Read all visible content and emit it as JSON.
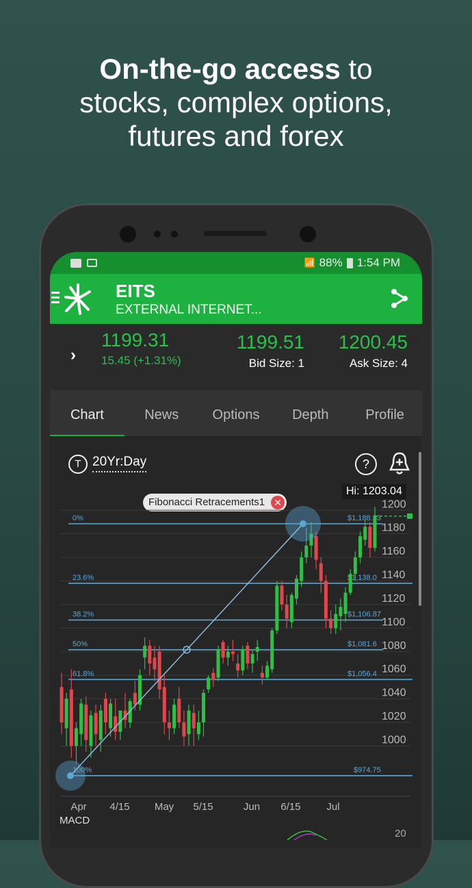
{
  "headline": {
    "bold": "On-the-go access",
    "rest_line1": " to",
    "line2": "stocks, complex options,",
    "line3": "futures and forex"
  },
  "status_bar": {
    "battery": "88%",
    "time": "1:54 PM",
    "icons": [
      "message-icon",
      "gmail-icon",
      "wifi-icon",
      "signal-icon",
      "battery-icon"
    ]
  },
  "header": {
    "symbol": "EITS",
    "name": "EXTERNAL INTERNET...",
    "icons": [
      "menu-icon",
      "logo-icon",
      "share-icon"
    ]
  },
  "quote": {
    "last": "1199.31",
    "change": "15.45 (+1.31%)",
    "bid": "1199.51",
    "bid_size": "Bid Size: 1",
    "ask": "1200.45",
    "ask_size": "Ask Size: 4"
  },
  "tabs": [
    {
      "label": "Chart",
      "active": true
    },
    {
      "label": "News"
    },
    {
      "label": "Options"
    },
    {
      "label": "Depth"
    },
    {
      "label": "Profile"
    }
  ],
  "chart_toolbar": {
    "period": "20Yr:Day",
    "hi": "Hi: 1203.04",
    "drawing_label": "Fibonacci Retracements1"
  },
  "colors": {
    "up": "#2fbf45",
    "down": "#e0474c",
    "fib": "#5aa7d6",
    "accent": "#1db23f"
  },
  "chart_data": {
    "type": "candlestick",
    "y_ticks": [
      1200,
      1180,
      1160,
      1140,
      1120,
      1100,
      1080,
      1060,
      1040,
      1020,
      1000
    ],
    "x_ticks": [
      "Apr",
      "4/15",
      "May",
      "5/15",
      "Jun",
      "6/15",
      "Jul"
    ],
    "fib_levels": [
      {
        "pct": "0%",
        "price": "$1,188.53",
        "value": 1188.53
      },
      {
        "pct": "23.6%",
        "price": "$1,138.0",
        "value": 1138.0
      },
      {
        "pct": "38.2%",
        "price": "$1,106.87",
        "value": 1106.87
      },
      {
        "pct": "50%",
        "price": "$1,081.6",
        "value": 1081.6
      },
      {
        "pct": "61.8%",
        "price": "$1,056.4",
        "value": 1056.4
      },
      {
        "pct": "100%",
        "price": "$974.75",
        "value": 974.75
      }
    ],
    "candles": [
      [
        1050,
        1062,
        1010,
        1020
      ],
      [
        1015,
        1045,
        1000,
        1040
      ],
      [
        1048,
        1065,
        990,
        1000
      ],
      [
        1000,
        1020,
        985,
        1015
      ],
      [
        1010,
        1040,
        1000,
        1036
      ],
      [
        1035,
        1042,
        995,
        1005
      ],
      [
        1000,
        1030,
        990,
        1026
      ],
      [
        1028,
        1035,
        1000,
        1010
      ],
      [
        1005,
        1035,
        995,
        1030
      ],
      [
        1040,
        1045,
        1010,
        1020
      ],
      [
        1015,
        1040,
        1008,
        1036
      ],
      [
        1025,
        1040,
        1005,
        1012
      ],
      [
        1012,
        1030,
        1005,
        1030
      ],
      [
        1030,
        1045,
        1015,
        1022
      ],
      [
        1020,
        1040,
        1015,
        1038
      ],
      [
        1045,
        1055,
        1030,
        1035
      ],
      [
        1035,
        1065,
        1030,
        1060
      ],
      [
        1075,
        1092,
        1065,
        1085
      ],
      [
        1085,
        1090,
        1060,
        1070
      ],
      [
        1075,
        1085,
        1055,
        1065
      ],
      [
        1080,
        1085,
        1040,
        1048
      ],
      [
        1050,
        1060,
        1010,
        1020
      ],
      [
        1020,
        1030,
        1005,
        1015
      ],
      [
        1015,
        1040,
        1010,
        1035
      ],
      [
        1040,
        1050,
        1015,
        1020
      ],
      [
        1020,
        1030,
        1000,
        1008
      ],
      [
        1010,
        1035,
        1000,
        1030
      ],
      [
        1028,
        1035,
        1000,
        1015
      ],
      [
        1010,
        1030,
        1005,
        1020
      ],
      [
        1020,
        1048,
        1008,
        1045
      ],
      [
        1048,
        1060,
        1045,
        1058
      ],
      [
        1062,
        1066,
        1050,
        1056
      ],
      [
        1058,
        1085,
        1055,
        1082
      ],
      [
        1088,
        1090,
        1070,
        1075
      ],
      [
        1075,
        1085,
        1068,
        1080
      ],
      [
        1080,
        1090,
        1072,
        1078
      ],
      [
        1070,
        1078,
        1058,
        1064
      ],
      [
        1064,
        1085,
        1060,
        1082
      ],
      [
        1085,
        1088,
        1065,
        1070
      ],
      [
        1070,
        1082,
        1062,
        1078
      ],
      [
        1080,
        1090,
        1072,
        1084
      ],
      [
        1062,
        1068,
        1052,
        1058
      ],
      [
        1058,
        1072,
        1056,
        1068
      ],
      [
        1065,
        1100,
        1062,
        1098
      ],
      [
        1098,
        1140,
        1095,
        1136
      ],
      [
        1136,
        1140,
        1115,
        1120
      ],
      [
        1120,
        1128,
        1100,
        1108
      ],
      [
        1105,
        1130,
        1100,
        1128
      ],
      [
        1125,
        1145,
        1120,
        1142
      ],
      [
        1140,
        1165,
        1135,
        1160
      ],
      [
        1160,
        1185,
        1155,
        1170
      ],
      [
        1170,
        1190,
        1160,
        1180
      ],
      [
        1178,
        1182,
        1150,
        1158
      ],
      [
        1155,
        1160,
        1130,
        1140
      ],
      [
        1140,
        1145,
        1100,
        1108
      ],
      [
        1108,
        1115,
        1095,
        1100
      ],
      [
        1100,
        1120,
        1095,
        1112
      ],
      [
        1110,
        1125,
        1098,
        1118
      ],
      [
        1112,
        1135,
        1105,
        1130
      ],
      [
        1130,
        1150,
        1128,
        1146
      ],
      [
        1146,
        1165,
        1140,
        1160
      ],
      [
        1160,
        1182,
        1155,
        1178
      ],
      [
        1175,
        1192,
        1170,
        1186
      ],
      [
        1186,
        1190,
        1160,
        1168
      ],
      [
        1168,
        1203,
        1165,
        1195
      ]
    ]
  },
  "macd": {
    "label": "MACD",
    "tick": "20"
  }
}
